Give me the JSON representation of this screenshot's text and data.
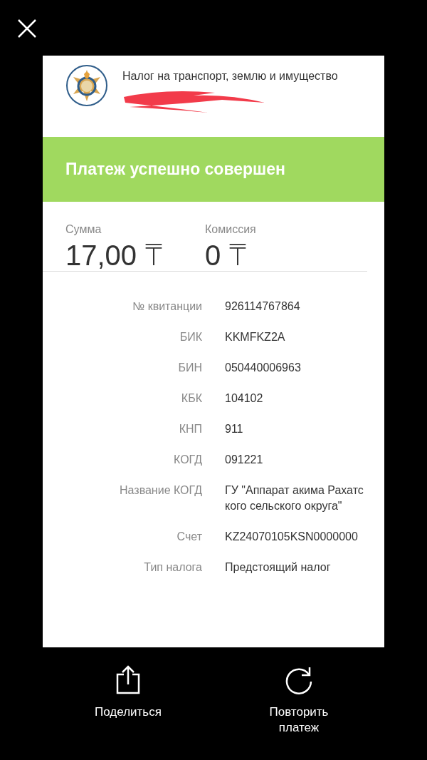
{
  "service": {
    "title": "Налог на транспорт, землю и имущество"
  },
  "status": {
    "message": "Платеж успешно совершен",
    "kind": "success"
  },
  "amounts": [
    {
      "label": "Сумма",
      "value": "17,00 ₸"
    },
    {
      "label": "Комиссия",
      "value": "0 ₸"
    }
  ],
  "details": [
    {
      "label": "№ квитанции",
      "value": "926114767864"
    },
    {
      "label": "БИК",
      "value": "KKMFKZ2A"
    },
    {
      "label": "БИН",
      "value": "050440006963"
    },
    {
      "label": "КБК",
      "value": "104102"
    },
    {
      "label": "КНП",
      "value": "911"
    },
    {
      "label": "КОГД",
      "value": "091221"
    },
    {
      "label": "Название КОГД",
      "value": "ГУ \"Аппарат акима Рахатского сельского округа\""
    },
    {
      "label": "Счет",
      "value": "KZ24070105KSN0000000"
    },
    {
      "label": "Тип налога",
      "value": "Предстоящий налог"
    }
  ],
  "actions": [
    {
      "label": "Поделиться",
      "kind": "share"
    },
    {
      "label": "Повторить платеж",
      "kind": "repeat"
    }
  ]
}
